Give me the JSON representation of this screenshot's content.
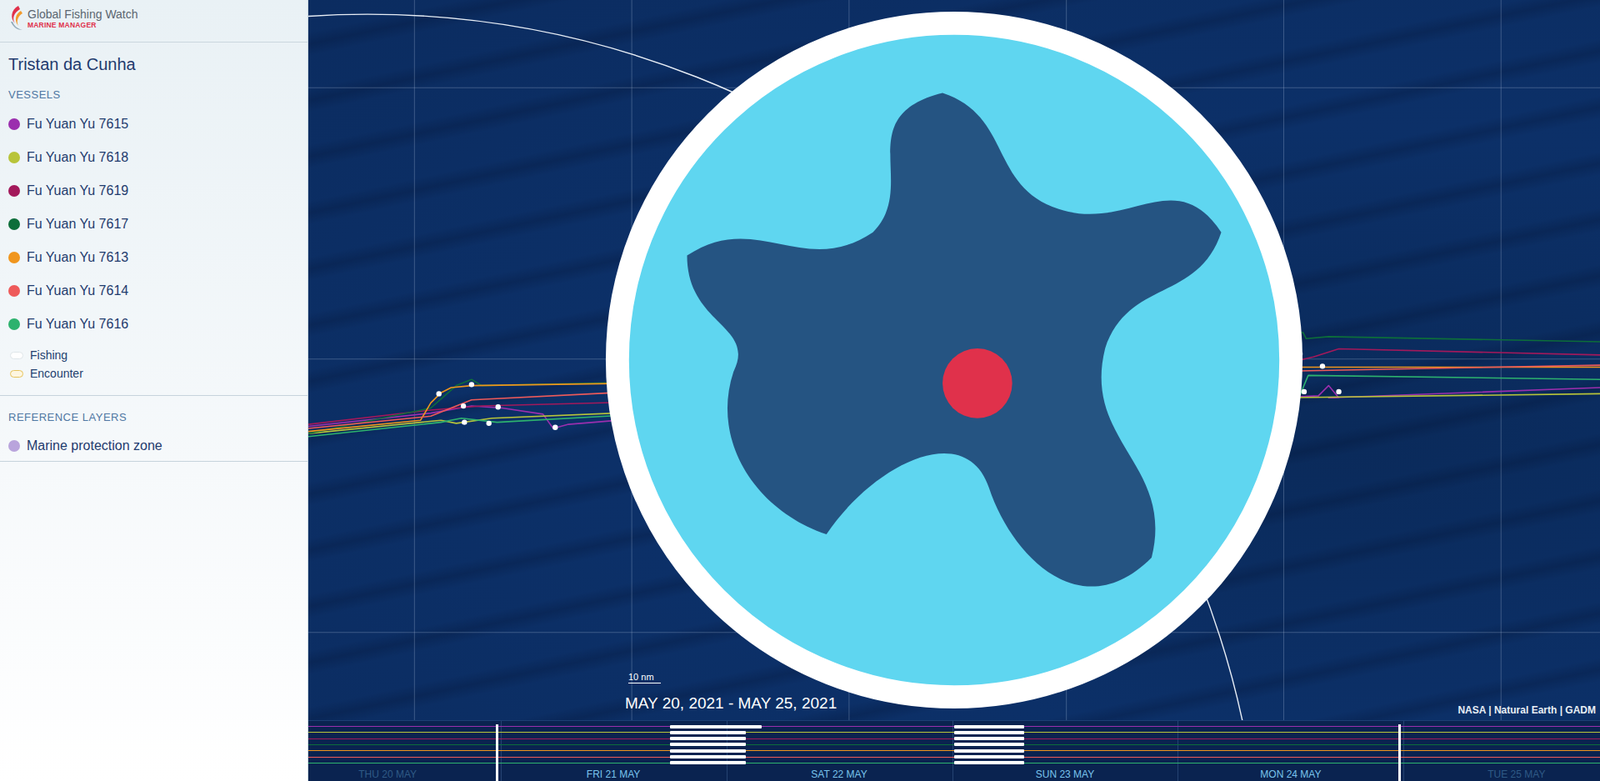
{
  "app": {
    "logo_title": "Global Fishing Watch",
    "logo_subtitle": "MARINE MANAGER"
  },
  "area": {
    "title": "Tristan da Cunha"
  },
  "vessels_section": {
    "label": "VESSELS"
  },
  "vessels": [
    {
      "name": "Fu Yuan Yu 7615",
      "color": "#9b2fae",
      "track": [
        [
          0,
          418
        ],
        [
          120,
          405
        ],
        [
          160,
          398
        ],
        [
          190,
          400
        ],
        [
          230,
          406
        ],
        [
          240,
          420
        ],
        [
          255,
          416
        ],
        [
          400,
          404
        ],
        [
          700,
          398
        ],
        [
          945,
          390
        ],
        [
          990,
          388
        ],
        [
          1000,
          378
        ],
        [
          1010,
          390
        ],
        [
          1000,
          390
        ],
        [
          1266,
          380
        ]
      ],
      "fishing": [
        [
          0.28,
          0.351
        ],
        [
          0.5,
          0.554
        ]
      ]
    },
    {
      "name": "Fu Yuan Yu 7618",
      "color": "#b8c43a",
      "track": [
        [
          0,
          425
        ],
        [
          130,
          412
        ],
        [
          145,
          415
        ],
        [
          180,
          410
        ],
        [
          400,
          401
        ],
        [
          700,
          396
        ],
        [
          950,
          390
        ],
        [
          1266,
          386
        ]
      ],
      "fishing": [
        [
          0.28,
          0.339
        ],
        [
          0.5,
          0.554
        ]
      ]
    },
    {
      "name": "Fu Yuan Yu 7619",
      "color": "#a3195b",
      "track": [
        [
          0,
          416
        ],
        [
          120,
          402
        ],
        [
          170,
          398
        ],
        [
          400,
          392
        ],
        [
          700,
          385
        ],
        [
          900,
          372
        ],
        [
          950,
          358
        ],
        [
          985,
          350
        ],
        [
          1010,
          342
        ],
        [
          1266,
          348
        ]
      ],
      "fishing": [
        [
          0.28,
          0.339
        ],
        [
          0.5,
          0.554
        ]
      ]
    },
    {
      "name": "Fu Yuan Yu 7617",
      "color": "#0d6e3a",
      "track": [
        [
          0,
          425
        ],
        [
          120,
          400
        ],
        [
          145,
          378
        ],
        [
          160,
          372
        ],
        [
          170,
          378
        ],
        [
          400,
          373
        ],
        [
          700,
          370
        ],
        [
          900,
          358
        ],
        [
          960,
          352
        ],
        [
          965,
          325
        ],
        [
          975,
          326
        ],
        [
          978,
          332
        ],
        [
          1000,
          330
        ],
        [
          1266,
          335
        ]
      ],
      "fishing": [
        [
          0.28,
          0.339
        ],
        [
          0.5,
          0.554
        ]
      ]
    },
    {
      "name": "Fu Yuan Yu 7613",
      "color": "#f0961e",
      "track": [
        [
          0,
          423
        ],
        [
          110,
          412
        ],
        [
          120,
          395
        ],
        [
          130,
          385
        ],
        [
          140,
          380
        ],
        [
          160,
          378
        ],
        [
          300,
          376
        ],
        [
          600,
          378
        ],
        [
          750,
          372
        ],
        [
          900,
          363
        ],
        [
          950,
          360
        ],
        [
          1266,
          360
        ]
      ],
      "fishing": [
        [
          0.28,
          0.339
        ],
        [
          0.5,
          0.554
        ]
      ]
    },
    {
      "name": "Fu Yuan Yu 7614",
      "color": "#ee5a5a",
      "track": [
        [
          0,
          420
        ],
        [
          120,
          408
        ],
        [
          160,
          392
        ],
        [
          300,
          385
        ],
        [
          600,
          380
        ],
        [
          900,
          368
        ],
        [
          950,
          364
        ],
        [
          1266,
          358
        ]
      ],
      "fishing": [
        [
          0.28,
          0.339
        ],
        [
          0.5,
          0.554
        ]
      ]
    },
    {
      "name": "Fu Yuan Yu 7616",
      "color": "#2db26e",
      "track": [
        [
          0,
          428
        ],
        [
          130,
          414
        ],
        [
          150,
          410
        ],
        [
          185,
          414
        ],
        [
          400,
          402
        ],
        [
          700,
          398
        ],
        [
          940,
          395
        ],
        [
          970,
          392
        ],
        [
          980,
          368
        ],
        [
          1266,
          372
        ]
      ],
      "fishing": [
        [
          0.28,
          0.339
        ],
        [
          0.5,
          0.554
        ]
      ]
    }
  ],
  "legend": [
    {
      "label": "Fishing",
      "kind": "fishing",
      "color": "#ffffff"
    },
    {
      "label": "Encounter",
      "kind": "encounter",
      "color": "#e6c35c"
    }
  ],
  "reference_layers": {
    "label": "REFERENCE LAYERS",
    "items": [
      {
        "name": "Marine protection zone",
        "color": "#b9a4dc"
      }
    ]
  },
  "map": {
    "date_range": "MAY 20, 2021 - MAY 25, 2021",
    "scale_label": "10 nm",
    "attribution": "NASA | Natural Earth | GADM",
    "fishing_events": [
      [
        128,
        386
      ],
      [
        160,
        377
      ],
      [
        152,
        398
      ],
      [
        186,
        399
      ],
      [
        153,
        414
      ],
      [
        177,
        415
      ],
      [
        242,
        419
      ],
      [
        972,
        347
      ],
      [
        994,
        359
      ],
      [
        925,
        365
      ],
      [
        950,
        363
      ],
      [
        947,
        391
      ],
      [
        976,
        384
      ],
      [
        1010,
        384
      ]
    ],
    "encounters": [
      [
        925,
        362
      ],
      [
        946,
        388
      ]
    ]
  },
  "timeline": {
    "days": [
      {
        "label": "THU 20 MAY",
        "in_range": false
      },
      {
        "label": "FRI 21 MAY",
        "in_range": true
      },
      {
        "label": "SAT 22 MAY",
        "in_range": true
      },
      {
        "label": "SUN 23 MAY",
        "in_range": true
      },
      {
        "label": "MON 24 MAY",
        "in_range": true
      },
      {
        "label": "TUE 25 MAY",
        "in_range": false
      }
    ],
    "selection": {
      "start": 0.145,
      "end": 0.844
    }
  }
}
